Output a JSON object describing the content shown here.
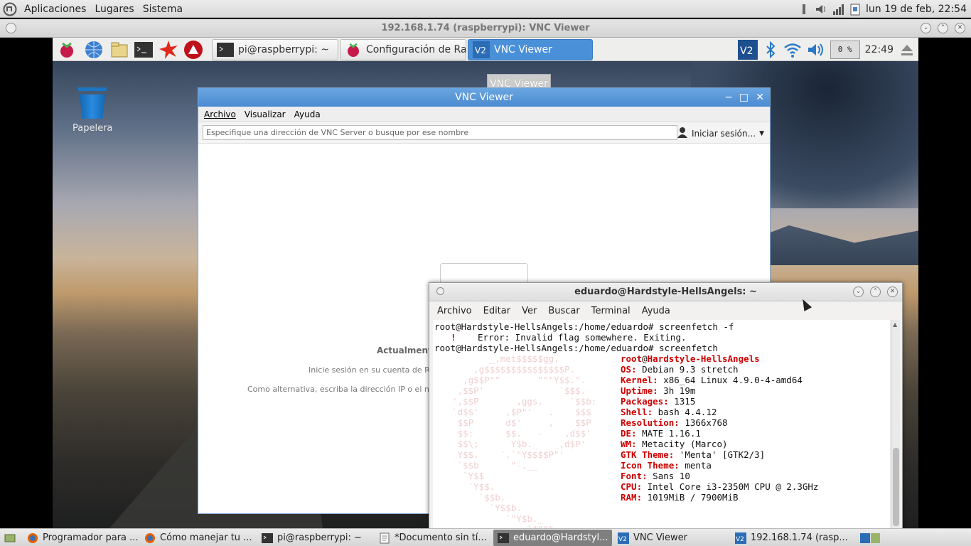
{
  "top_panel": {
    "menus": [
      "Aplicaciones",
      "Lugares",
      "Sistema"
    ],
    "clock": "lun 19 de feb, 22:54"
  },
  "vnc_window": {
    "title": "192.168.1.74 (raspberrypi): VNC Viewer"
  },
  "pi_panel": {
    "tasks": [
      {
        "label": "pi@raspberrypi: ~"
      },
      {
        "label": "Configuración de Ras..."
      },
      {
        "label": "VNC Viewer"
      }
    ],
    "cpu": "0 %",
    "clock": "22:49",
    "tooltip": "VNC Viewer"
  },
  "pi_desktop": {
    "trash_label": "Papelera"
  },
  "inner_vnc": {
    "title": "VNC Viewer",
    "menu": [
      "Archivo",
      "Visualizar",
      "Ayuda"
    ],
    "search_placeholder": "Especifique una dirección de VNC Server o busque por ese nombre",
    "signin": "Iniciar sesión...",
    "status_title": "Actualmente n",
    "status_line1": "Inicie sesión en su cuenta de Rea",
    "status_line2": "Como alternativa, escriba la dirección IP o el nomb"
  },
  "terminal": {
    "title": "eduardo@Hardstyle-HellsAngels: ~",
    "menu": [
      "Archivo",
      "Editar",
      "Ver",
      "Buscar",
      "Terminal",
      "Ayuda"
    ],
    "lines": {
      "l1": "root@Hardstyle-HellsAngels:/home/eduardo# screenfetch -f",
      "l2_mark": "!",
      "l2": "Error: Invalid flag somewhere. Exiting.",
      "l3": "root@Hardstyle-HellsAngels:/home/eduardo# screenfetch"
    },
    "info": {
      "user": "root",
      "at": "@",
      "host": "Hardstyle-HellsAngels",
      "rows": [
        {
          "k": "OS:",
          "v": " Debian 9.3 stretch"
        },
        {
          "k": "Kernel:",
          "v": " x86_64 Linux 4.9.0-4-amd64"
        },
        {
          "k": "Uptime:",
          "v": " 3h 19m"
        },
        {
          "k": "Packages:",
          "v": " 1315"
        },
        {
          "k": "Shell:",
          "v": " bash 4.4.12"
        },
        {
          "k": "Resolution:",
          "v": " 1366x768"
        },
        {
          "k": "DE:",
          "v": " MATE 1.16.1"
        },
        {
          "k": "WM:",
          "v": " Metacity (Marco)"
        },
        {
          "k": "GTK Theme:",
          "v": " 'Menta' [GTK2/3]"
        },
        {
          "k": "Icon Theme:",
          "v": " menta"
        },
        {
          "k": "Font:",
          "v": " Sans 10"
        },
        {
          "k": "CPU:",
          "v": " Intel Core i3-2350M CPU @ 2.3GHz"
        },
        {
          "k": "RAM:",
          "v": " 1019MiB / 7900MiB"
        }
      ]
    },
    "logo": [
      "         _,met$$$$$gg.",
      "      ,g$$$$$$$$$$$$$$$P.",
      "    ,g$$P\"\"       \"\"\"Y$$.\".",
      "   ,$$P'              `$$$.",
      "  ',$$P       ,ggs.     `$$b:",
      "  `d$$'     ,$P\"'   .    $$$",
      "   $$P      d$'     ,    $$P",
      "   $$:      $$.   -    ,d$$'",
      "   $$\\;      Y$b._   _,d$P'",
      "   Y$$.    `.`\"Y$$$$P\"'",
      "   `$$b      \"-.__",
      "    `Y$$",
      "     `Y$$.",
      "       `$$b.",
      "         `Y$$b.",
      "            `\"Y$b._",
      "                `\"\"\"\""
    ]
  },
  "taskbar": {
    "items": [
      {
        "label": "Programador para ..."
      },
      {
        "label": "Cómo manejar tu ..."
      },
      {
        "label": "pi@raspberrypi: ~"
      },
      {
        "label": "*Documento sin tí..."
      },
      {
        "label": "eduardo@Hardstyl..."
      },
      {
        "label": "VNC Viewer"
      },
      {
        "label": "192.168.1.74 (rasp..."
      }
    ]
  }
}
